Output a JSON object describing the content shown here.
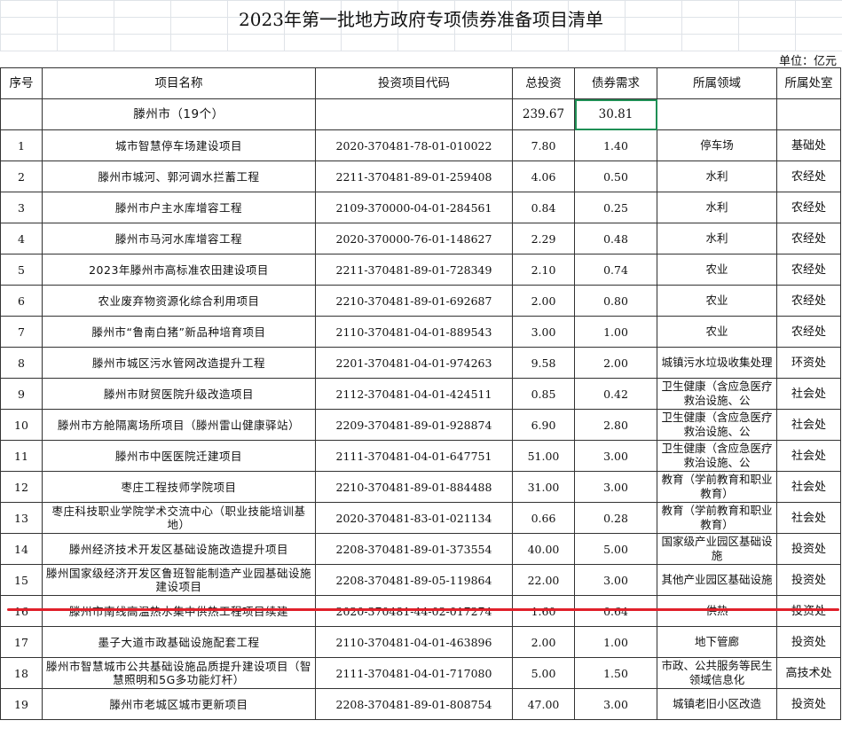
{
  "title": "2023年第一批地方政府专项债券准备项目清单",
  "unit": "单位：亿元",
  "headers": [
    "序号",
    "项目名称",
    "投资项目代码",
    "总投资",
    "债券需求",
    "所属领域",
    "所属处室"
  ],
  "total": {
    "name": "滕州市（19个）",
    "investment": "239.67",
    "bond": "30.81"
  },
  "rows": [
    {
      "no": "1",
      "name": "城市智慧停车场建设项目",
      "code": "2020-370481-78-01-010022",
      "investment": "7.80",
      "bond": "1.40",
      "field": "停车场",
      "office": "基础处"
    },
    {
      "no": "2",
      "name": "滕州市城河、郭河调水拦蓄工程",
      "code": "2211-370481-89-01-259408",
      "investment": "4.06",
      "bond": "0.50",
      "field": "水利",
      "office": "农经处"
    },
    {
      "no": "3",
      "name": "滕州市户主水库增容工程",
      "code": "2109-370000-04-01-284561",
      "investment": "0.84",
      "bond": "0.25",
      "field": "水利",
      "office": "农经处"
    },
    {
      "no": "4",
      "name": "滕州市马河水库增容工程",
      "code": "2020-370000-76-01-148627",
      "investment": "2.29",
      "bond": "0.48",
      "field": "水利",
      "office": "农经处"
    },
    {
      "no": "5",
      "name": "2023年滕州市高标准农田建设项目",
      "code": "2211-370481-89-01-728349",
      "investment": "2.10",
      "bond": "0.74",
      "field": "农业",
      "office": "农经处"
    },
    {
      "no": "6",
      "name": "农业废弃物资源化综合利用项目",
      "code": "2210-370481-89-01-692687",
      "investment": "2.00",
      "bond": "0.80",
      "field": "农业",
      "office": "农经处"
    },
    {
      "no": "7",
      "name": "滕州市“鲁南白猪”新品种培育项目",
      "code": "2110-370481-04-01-889543",
      "investment": "3.00",
      "bond": "1.00",
      "field": "农业",
      "office": "农经处"
    },
    {
      "no": "8",
      "name": "滕州市城区污水管网改造提升工程",
      "code": "2201-370481-04-01-974263",
      "investment": "9.58",
      "bond": "2.00",
      "field": "城镇污水垃圾收集处理",
      "office": "环资处"
    },
    {
      "no": "9",
      "name": "滕州市财贸医院升级改造项目",
      "code": "2112-370481-04-01-424511",
      "investment": "0.85",
      "bond": "0.42",
      "field": "卫生健康（含应急医疗救治设施、公",
      "office": "社会处"
    },
    {
      "no": "10",
      "name": "滕州市方舱隔离场所项目（滕州雷山健康驿站）",
      "code": "2209-370481-89-01-928874",
      "investment": "6.90",
      "bond": "2.80",
      "field": "卫生健康（含应急医疗救治设施、公",
      "office": "社会处"
    },
    {
      "no": "11",
      "name": "滕州市中医医院迁建项目",
      "code": "2111-370481-04-01-647751",
      "investment": "51.00",
      "bond": "3.00",
      "field": "卫生健康（含应急医疗救治设施、公",
      "office": "社会处"
    },
    {
      "no": "12",
      "name": "枣庄工程技师学院项目",
      "code": "2210-370481-89-01-884488",
      "investment": "31.00",
      "bond": "3.00",
      "field": "教育（学前教育和职业教育）",
      "office": "社会处"
    },
    {
      "no": "13",
      "name": "枣庄科技职业学院学术交流中心（职业技能培训基地）",
      "code": "2020-370481-83-01-021134",
      "investment": "0.66",
      "bond": "0.28",
      "field": "教育（学前教育和职业教育）",
      "office": "社会处"
    },
    {
      "no": "14",
      "name": "滕州经济技术开发区基础设施改造提升项目",
      "code": "2208-370481-89-01-373554",
      "investment": "40.00",
      "bond": "5.00",
      "field": "国家级产业园区基础设施",
      "office": "投资处"
    },
    {
      "no": "15",
      "name": "滕州国家级经济开发区鲁班智能制造产业园基础设施建设项目",
      "code": "2208-370481-89-05-119864",
      "investment": "22.00",
      "bond": "3.00",
      "field": "其他产业园区基础设施",
      "office": "投资处"
    },
    {
      "no": "16",
      "name": "滕州市南线高温热水集中供热工程项目续建",
      "code": "2020-370481-44-02-017274",
      "investment": "1.60",
      "bond": "0.64",
      "field": "供热",
      "office": "投资处"
    },
    {
      "no": "17",
      "name": "墨子大道市政基础设施配套工程",
      "code": "2110-370481-04-01-463896",
      "investment": "2.00",
      "bond": "1.00",
      "field": "地下管廊",
      "office": "投资处"
    },
    {
      "no": "18",
      "name": "滕州市智慧城市公共基础设施品质提升建设项目（智慧照明和5G多功能灯杆）",
      "code": "2111-370481-04-01-717080",
      "investment": "5.00",
      "bond": "1.50",
      "field": "市政、公共服务等民生领域信息化",
      "office": "高技术处"
    },
    {
      "no": "19",
      "name": "滕州市老城区城市更新项目",
      "code": "2208-370481-89-01-808754",
      "investment": "47.00",
      "bond": "3.00",
      "field": "城镇老旧小区改造",
      "office": "投资处"
    }
  ]
}
